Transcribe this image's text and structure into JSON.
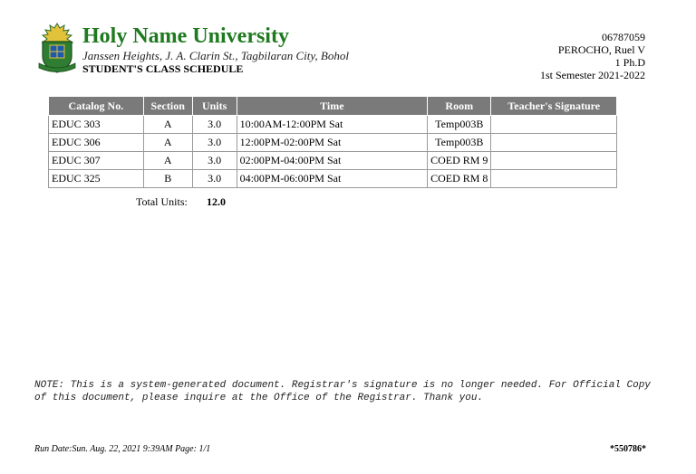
{
  "header": {
    "university": "Holy Name University",
    "address": "Janssen Heights, J. A. Clarin St., Tagbilaran City, Bohol",
    "document_title": "STUDENT'S CLASS SCHEDULE",
    "logo_text": "HOLY NAME UNIVERSITY",
    "logo_motto": "Lilium & Veritas"
  },
  "student": {
    "id": "06787059",
    "name": "PEROCHO, Ruel V",
    "program": "1 Ph.D",
    "term": "1st Semester 2021-2022"
  },
  "table": {
    "headers": [
      "Catalog No.",
      "Section",
      "Units",
      "Time",
      "Room",
      "Teacher's Signature"
    ],
    "rows": [
      {
        "catalog": "EDUC 303",
        "section": "A",
        "units": "3.0",
        "time": "10:00AM-12:00PM Sat",
        "room": "Temp003B",
        "signature": ""
      },
      {
        "catalog": "EDUC 306",
        "section": "A",
        "units": "3.0",
        "time": "12:00PM-02:00PM Sat",
        "room": "Temp003B",
        "signature": ""
      },
      {
        "catalog": "EDUC 307",
        "section": "A",
        "units": "3.0",
        "time": "02:00PM-04:00PM Sat",
        "room": "COED RM 9",
        "signature": ""
      },
      {
        "catalog": "EDUC 325",
        "section": "B",
        "units": "3.0",
        "time": "04:00PM-06:00PM Sat",
        "room": "COED RM 8",
        "signature": ""
      }
    ]
  },
  "totals": {
    "label": "Total Units:",
    "value": "12.0"
  },
  "note": "NOTE: This is a system-generated document. Registrar's signature is no longer needed. For Official Copy of this document, please inquire at the Office of the Registrar. Thank you.",
  "footer": {
    "run_date": "Run Date:Sun. Aug. 22, 2021 9:39AM  Page: 1/1",
    "code": "*550786*"
  },
  "colors": {
    "university_green": "#1f7a1f",
    "header_gray": "#7a7a7a",
    "logo_gold": "#e2c23a"
  }
}
